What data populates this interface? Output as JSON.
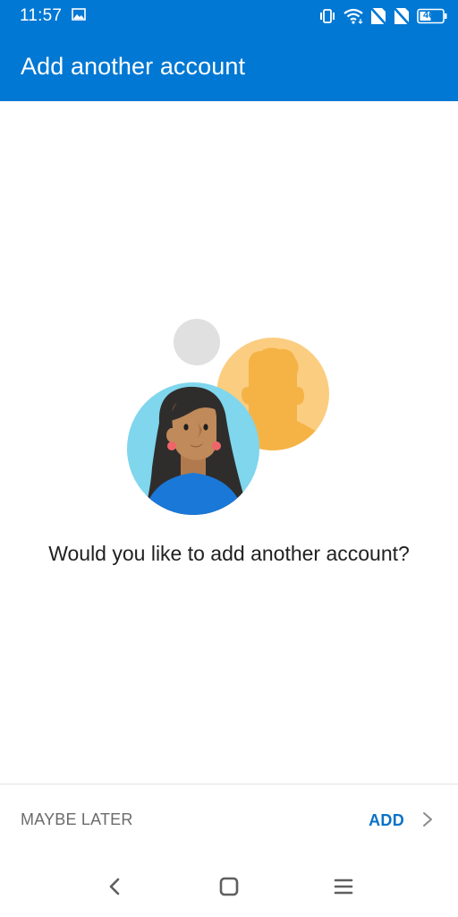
{
  "status_bar": {
    "time": "11:57",
    "battery_level": "46",
    "icons": [
      "gallery-icon",
      "vibrate-icon",
      "wifi-icon",
      "no-sim-icon",
      "no-sim-icon",
      "battery-icon"
    ]
  },
  "app_bar": {
    "title": "Add another account"
  },
  "main": {
    "illustration": "account-avatars-illustration",
    "question": "Would you like to add another account?"
  },
  "footer": {
    "maybe_later_label": "MAYBE LATER",
    "add_label": "ADD"
  },
  "nav_bar": {
    "buttons": [
      "back",
      "home",
      "recents-menu"
    ]
  },
  "colors": {
    "primary": "#0078d4",
    "accent_text": "#0a72c5",
    "secondary_text": "#6b6b6b",
    "body_text": "#212121"
  }
}
